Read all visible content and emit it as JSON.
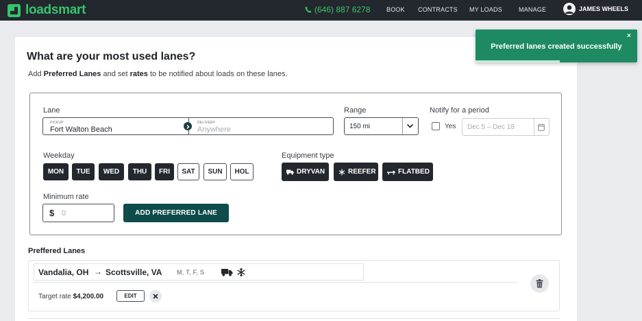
{
  "nav": {
    "brand": "loadsmart",
    "phone": "(646) 887 6278",
    "links": [
      "BOOK",
      "CONTRACTS",
      "MY LOADS",
      "MANAGE"
    ],
    "user": "JAMES WHEELS"
  },
  "page": {
    "title": "What are your most used lanes?",
    "subtitle_pre": "Add ",
    "subtitle_b1": "Preferred Lanes",
    "subtitle_mid": " and set ",
    "subtitle_b2": "rates",
    "subtitle_post": " to be notified about loads on these lanes."
  },
  "form": {
    "lane_label": "Lane",
    "pickup_caption": "PICKUP",
    "pickup_value": "Fort Walton Beach",
    "delivery_caption": "DELIVERY",
    "delivery_placeholder": "Anywhere",
    "range_label": "Range",
    "range_value": "150 mi",
    "notify_label": "Notify for a period",
    "notify_yes": "Yes",
    "date_range": "Dec 5 – Dec 18",
    "weekday_label": "Weekday",
    "days": [
      {
        "label": "MON",
        "selected": true
      },
      {
        "label": "TUE",
        "selected": true
      },
      {
        "label": "WED",
        "selected": true
      },
      {
        "label": "THU",
        "selected": true
      },
      {
        "label": "FRI",
        "selected": true
      },
      {
        "label": "SAT",
        "selected": false
      },
      {
        "label": "SUN",
        "selected": false
      },
      {
        "label": "HOL",
        "selected": false
      }
    ],
    "equipment_label": "Equipment type",
    "equipment": [
      "DRYVAN",
      "REEFER",
      "FLATBED"
    ],
    "min_rate_label": "Minimum rate",
    "min_rate_currency": "$",
    "min_rate_placeholder": "0",
    "add_button": "ADD PREFERRED LANE"
  },
  "preferred": {
    "title": "Preffered Lanes",
    "lanes": [
      {
        "origin": "Vandalia, OH",
        "arrow": "→",
        "destination": "Scottsville, VA",
        "days": "M, T, F, S",
        "target_label": "Target rate",
        "target_value": "$4,200.00",
        "edit_label": "EDIT"
      }
    ]
  },
  "toast": {
    "message": "Preferred lanes created successfully",
    "close": "×",
    "progress": 0.52
  },
  "colors": {
    "nav_bg": "#23272e",
    "brand_green": "#36c46c",
    "primary_button": "#0d4c4b",
    "toast_bg": "#1d8a61"
  }
}
